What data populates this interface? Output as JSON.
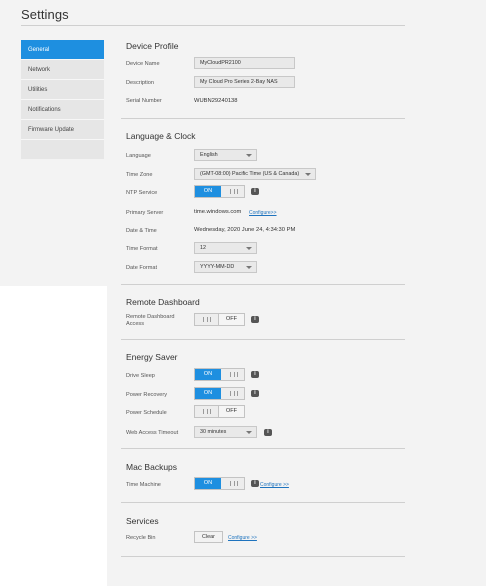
{
  "page": {
    "title": "Settings"
  },
  "sidebar": {
    "items": [
      {
        "label": "General",
        "active": true
      },
      {
        "label": "Network"
      },
      {
        "label": "Utilities"
      },
      {
        "label": "Notifications"
      },
      {
        "label": "Firmware Update"
      }
    ]
  },
  "device_profile": {
    "title": "Device Profile",
    "device_name_label": "Device Name",
    "device_name_value": "MyCloudPR2100",
    "description_label": "Description",
    "description_value": "My Cloud Pro Series 2-Bay NAS",
    "serial_label": "Serial Number",
    "serial_value": "WUBN29240138"
  },
  "language_clock": {
    "title": "Language & Clock",
    "language_label": "Language",
    "language_value": "English",
    "timezone_label": "Time Zone",
    "timezone_value": "(GMT-08:00) Pacific Time (US & Canada)",
    "ntp_label": "NTP Service",
    "ntp_state": "ON",
    "primary_server_label": "Primary Server",
    "primary_server_value": "time.windows.com",
    "configure_link": "Configure>>",
    "datetime_label": "Date & Time",
    "datetime_value": "Wednesday, 2020 June 24, 4:34:30 PM",
    "time_format_label": "Time Format",
    "time_format_value": "12",
    "date_format_label": "Date Format",
    "date_format_value": "YYYY-MM-DD"
  },
  "remote_dashboard": {
    "title": "Remote Dashboard",
    "access_label_line1": "Remote Dashboard",
    "access_label_line2": "Access",
    "access_state": "OFF"
  },
  "energy_saver": {
    "title": "Energy Saver",
    "drive_sleep_label": "Drive Sleep",
    "drive_sleep_state": "ON",
    "power_recovery_label": "Power Recovery",
    "power_recovery_state": "ON",
    "power_schedule_label": "Power Schedule",
    "power_schedule_state": "OFF",
    "web_timeout_label": "Web Access Timeout",
    "web_timeout_value": "30 minutes"
  },
  "mac_backups": {
    "title": "Mac Backups",
    "time_machine_label": "Time Machine",
    "time_machine_state": "ON",
    "configure_link": "Configure >>"
  },
  "services": {
    "title": "Services",
    "recycle_bin_label": "Recycle Bin",
    "clear_label": "Clear",
    "configure_link": "Configure >>"
  },
  "icons": {
    "info": "i"
  },
  "colors": {
    "accent": "#1e8fe0",
    "link": "#1e73be"
  }
}
